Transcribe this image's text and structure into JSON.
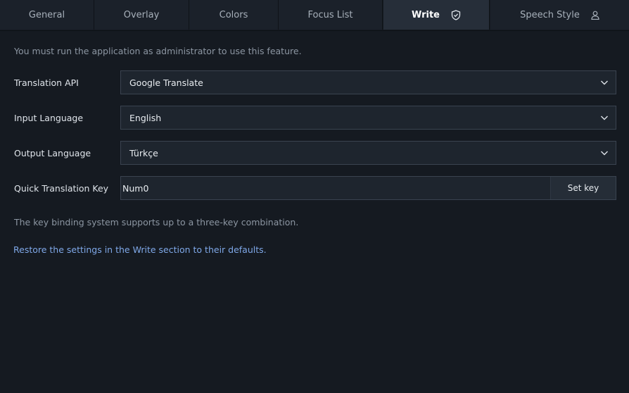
{
  "tabs": [
    {
      "label": "General",
      "active": false
    },
    {
      "label": "Overlay",
      "active": false
    },
    {
      "label": "Colors",
      "active": false
    },
    {
      "label": "Focus List",
      "active": false
    },
    {
      "label": "Write",
      "active": true,
      "icon": "shield-check-icon"
    },
    {
      "label": "Speech Style",
      "active": false,
      "icon": "person-icon"
    }
  ],
  "write": {
    "admin_notice": "You must run the application as administrator to use this feature.",
    "translation_api": {
      "label": "Translation API",
      "value": "Google Translate"
    },
    "input_language": {
      "label": "Input Language",
      "value": "English"
    },
    "output_language": {
      "label": "Output Language",
      "value": "Türkçe"
    },
    "quick_key": {
      "label": "Quick Translation Key",
      "value": "Num0",
      "button_label": "Set key"
    },
    "hint": "The key binding system supports up to a three-key combination.",
    "restore_link": "Restore the settings in the Write section to their defaults."
  },
  "colors": {
    "background": "#151a21",
    "tab_active": "#262e39",
    "link": "#7fa8e8"
  }
}
